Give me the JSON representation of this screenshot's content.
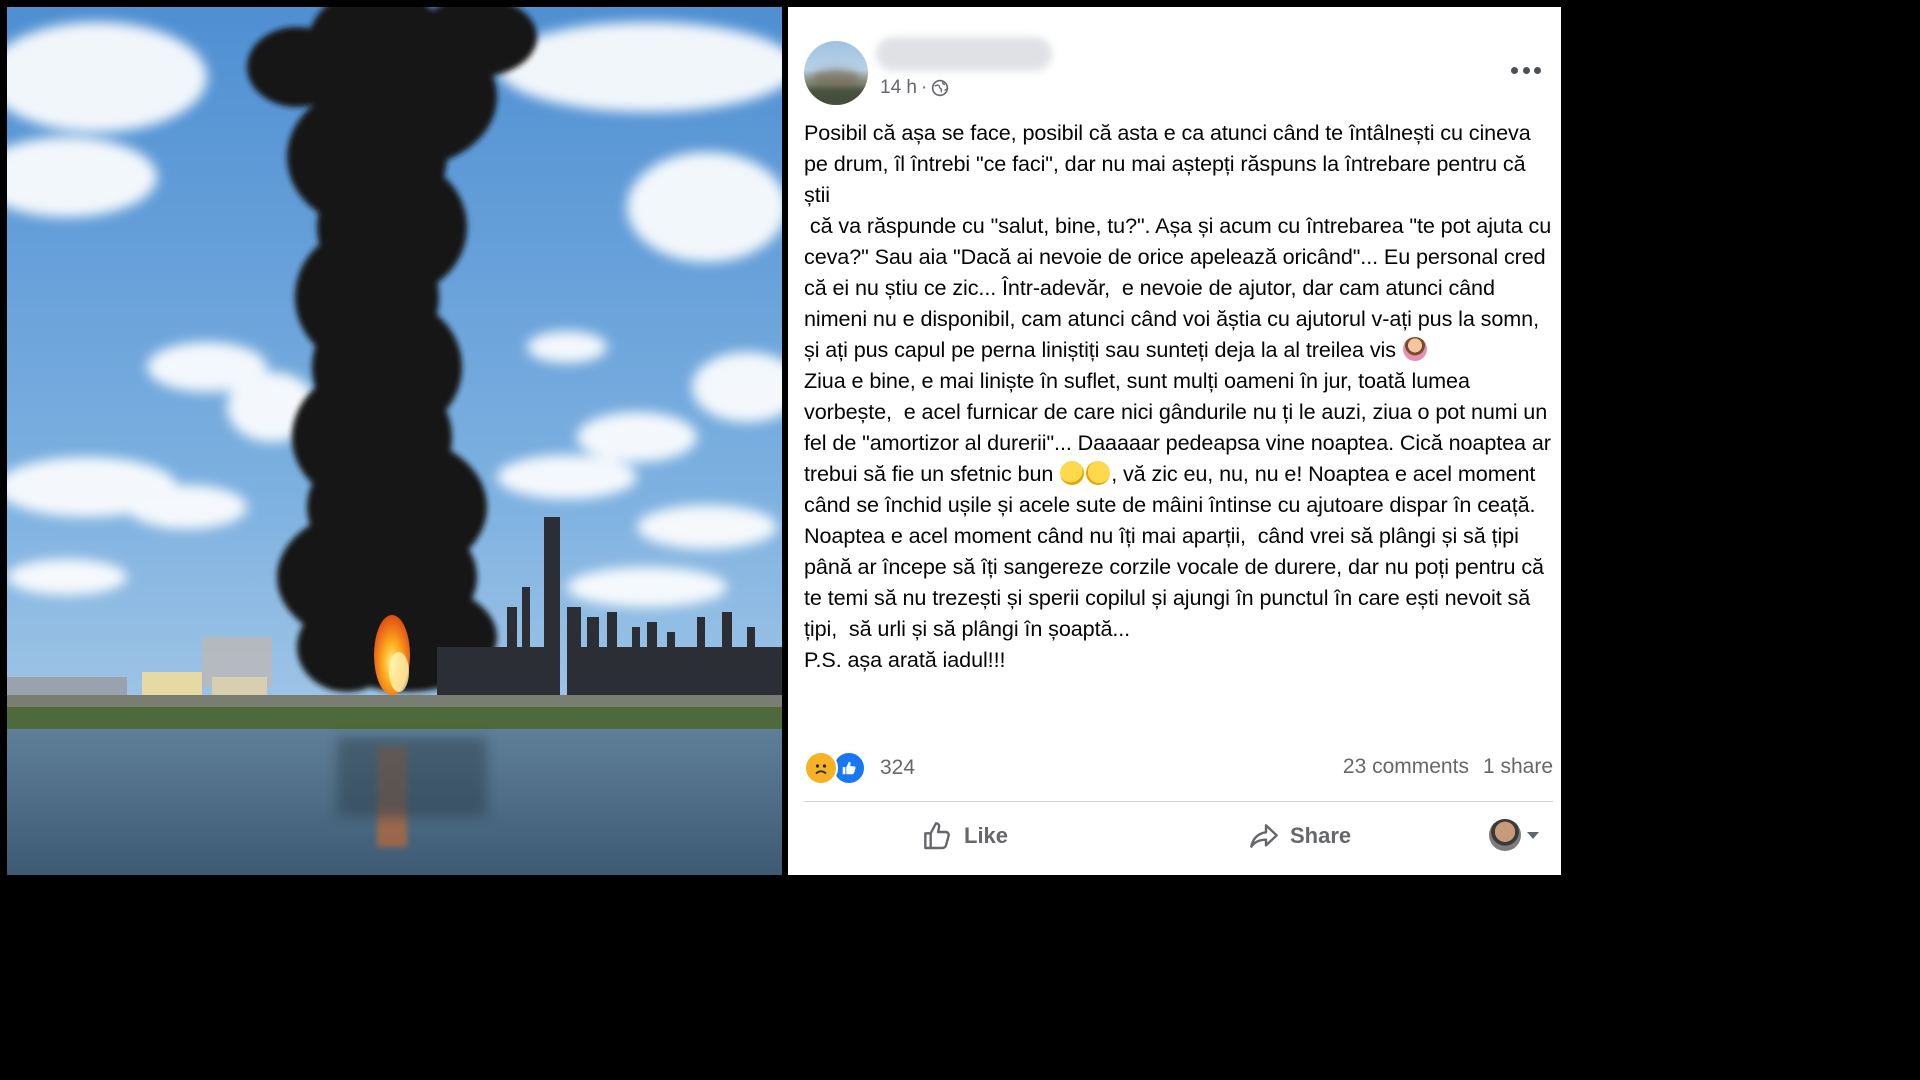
{
  "post": {
    "timestamp": "14 h",
    "separator": "·",
    "privacy_icon": "globe-icon",
    "menu_icon": "more-options-icon",
    "paragraphs": [
      "Posibil că așa se face, posibil că asta e ca atunci când te întâlnești cu cineva pe drum, îl întrebi \"ce faci\", dar nu mai aștepți răspuns la întrebare pentru că știi",
      " că va răspunde cu \"salut, bine, tu?\". Așa și acum cu întrebarea \"te pot ajuta cu ceva?\" Sau aia \"Dacă ai nevoie de orice apelează oricând\"... Eu personal cred că ei nu știu ce zic... Într-adevăr,  e nevoie de ajutor, dar cam atunci când nimeni nu e disponibil, cam atunci când voi ăștia cu ajutorul v-ați pus la somn, și ați pus capul pe perna liniștiți sau sunteți deja la al treilea vis "
    ],
    "paragraph3_a": "Ziua e bine, e mai liniște în suflet, sunt mulți oameni în jur, toată lumea vorbește,  e acel furnicar de care nici gândurile nu ți le auzi, ziua o pot numi un fel de \"amortizor al durerii\"... Daaaaar pedeapsa vine noaptea. Cică noaptea ar trebui să fie un sfetnic bun ",
    "paragraph3_b": ", vă zic eu, nu, nu e! Noaptea e acel moment când se închid ușile și acele sute de mâini întinse cu ajutoare dispar în ceață. Noaptea e acel moment când nu îți mai aparții,  când vrei să plângi și să țipi până ar începe să îți sangereze corzile vocale de durere, dar nu poți pentru că te temi să nu trezești și sperii copilul și ajungi în punctul în care ești nevoit să țipi,  să urli și să plângi în șoaptă...",
    "paragraph4": "P.S. așa arată iadul!!!",
    "reaction_count": "324",
    "comments": "23 comments",
    "shares": "1 share"
  },
  "actions": {
    "like_label": "Like",
    "share_label": "Share"
  },
  "colors": {
    "secondary_text": "#65676b",
    "like_blue": "#1877f2",
    "sad_yellow": "#f7b125",
    "divider": "#ced0d4"
  }
}
